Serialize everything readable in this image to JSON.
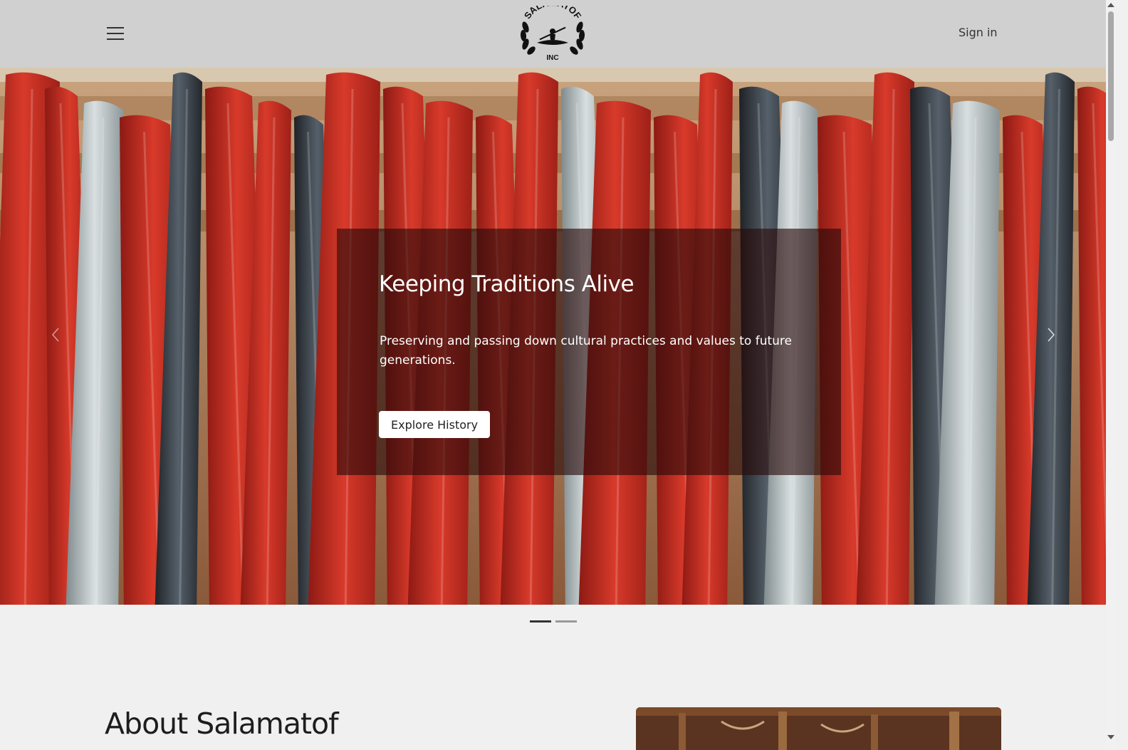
{
  "header": {
    "menu_icon": "hamburger-menu-icon",
    "logo_text_top": "SALAMATOF",
    "logo_text_bottom": "INC",
    "signin_label": "Sign in"
  },
  "hero": {
    "title": "Keeping Traditions Alive",
    "description": "Preserving and passing down cultural practices and values to future generations.",
    "button_label": "Explore History",
    "prev_icon": "chevron-left-icon",
    "next_icon": "chevron-right-icon",
    "slide_count": 2,
    "active_slide": 1
  },
  "about": {
    "title": "About Salamatof"
  },
  "colors": {
    "header_bg": "#d0d0d0",
    "page_bg": "#f0f0f0",
    "indicator_active": "#333333",
    "indicator_inactive": "#999999"
  }
}
